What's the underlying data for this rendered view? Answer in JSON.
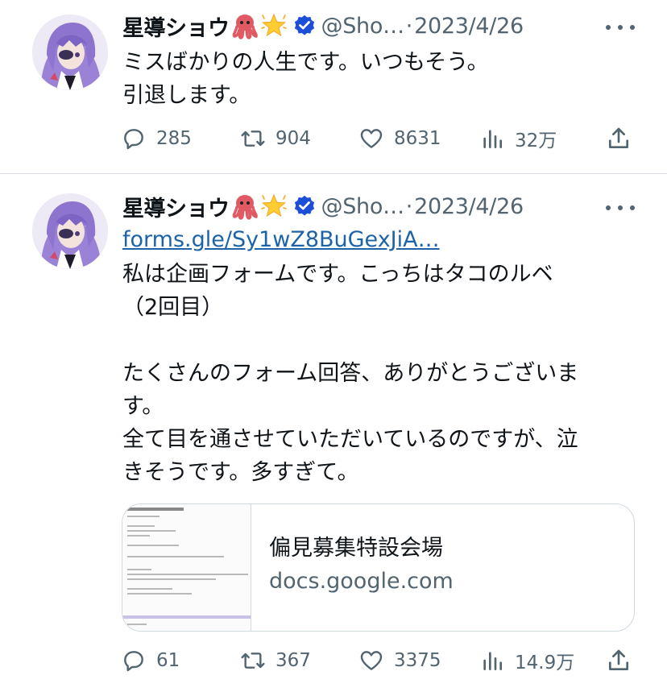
{
  "tweets": [
    {
      "author_name": "星導ショウ",
      "name_emojis": [
        "octopus-emoji",
        "glowing-star-emoji"
      ],
      "handle": "@Sho…",
      "separator": "·",
      "date": "2023/4/26",
      "text": "ミスばかりの人生です。いつもそう。\n引退します。",
      "replies": "285",
      "retweets": "904",
      "likes": "8631",
      "views": "32万"
    },
    {
      "author_name": "星導ショウ",
      "name_emojis": [
        "octopus-emoji",
        "glowing-star-emoji"
      ],
      "handle": "@Sho…",
      "separator": "·",
      "date": "2023/4/26",
      "link": "forms.gle/Sy1wZ8BuGexJiA…",
      "text": "私は企画フォームです。こっちはタコのルベ\n（2回目）\n\nたくさんのフォーム回答、ありがとうございま\nす。\n全て目を通させていただいているのですが、泣\nきそうです。多すぎて。",
      "card": {
        "title": "偏見募集特設会場",
        "domain": "docs.google.com"
      },
      "replies": "61",
      "retweets": "367",
      "likes": "3375",
      "views": "14.9万"
    }
  ],
  "colors": {
    "text": "#0f1419",
    "secondary": "#536471",
    "link": "#1d63a8",
    "verified": "#1d9bf0",
    "border": "#cfd9de"
  }
}
